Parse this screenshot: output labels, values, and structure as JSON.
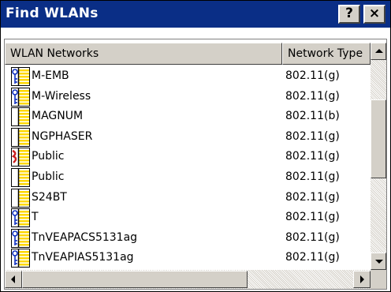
{
  "window": {
    "title": "Find WLANs",
    "help_label": "?",
    "close_label": "×"
  },
  "columns": {
    "networks": "WLAN Networks",
    "type": "Network Type"
  },
  "networks": [
    {
      "name": "M-EMB",
      "type": "802.11(g)",
      "icon": "secured-signal-icon"
    },
    {
      "name": "M-Wireless",
      "type": "802.11(g)",
      "icon": "secured-signal-icon"
    },
    {
      "name": "MAGNUM",
      "type": "802.11(b)",
      "icon": "open-signal-icon"
    },
    {
      "name": "NGPHASER",
      "type": "802.11(g)",
      "icon": "open-signal-icon"
    },
    {
      "name": "Public",
      "type": "802.11(g)",
      "icon": "disconnected-signal-icon"
    },
    {
      "name": "Public",
      "type": "802.11(g)",
      "icon": "open-signal-icon"
    },
    {
      "name": "S24BT",
      "type": "802.11(g)",
      "icon": "open-signal-icon"
    },
    {
      "name": "T",
      "type": "802.11(g)",
      "icon": "secured-signal-icon"
    },
    {
      "name": "TnVEAPACS5131ag",
      "type": "802.11(g)",
      "icon": "secured-signal-icon"
    },
    {
      "name": "TnVEAPIAS5131ag",
      "type": "802.11(g)",
      "icon": "secured-signal-icon"
    }
  ],
  "colors": {
    "titlebar": "#0a2e86",
    "signal": "#ffd800",
    "key": "#1030c0",
    "disconnected": "#cc2020"
  }
}
